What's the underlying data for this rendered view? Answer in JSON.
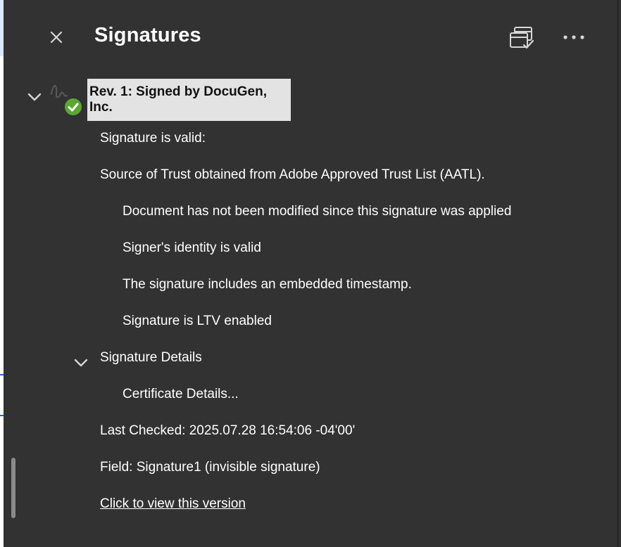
{
  "panel": {
    "title": "Signatures",
    "icons": {
      "close": "close-icon",
      "validate_all": "validate-all-signatures-icon",
      "more": "more-options-icon"
    }
  },
  "signature": {
    "header": "Rev. 1: Signed by DocuGen, Inc.",
    "status_color": "#5aa832",
    "status_lines": {
      "valid": "Signature is valid:",
      "trust_source": "Source of Trust obtained from Adobe Approved Trust List (AATL)."
    },
    "checks": [
      "Document has not been modified since this signature was applied",
      "Signer's identity is valid",
      "The signature includes an embedded timestamp.",
      "Signature is LTV enabled"
    ],
    "details": {
      "label": "Signature Details",
      "certificate_link": "Certificate Details..."
    },
    "last_checked": "Last Checked: 2025.07.28 16:54:06 -04'00'",
    "field": "Field: Signature1 (invisible signature)",
    "view_version_link": "Click to view this version"
  }
}
